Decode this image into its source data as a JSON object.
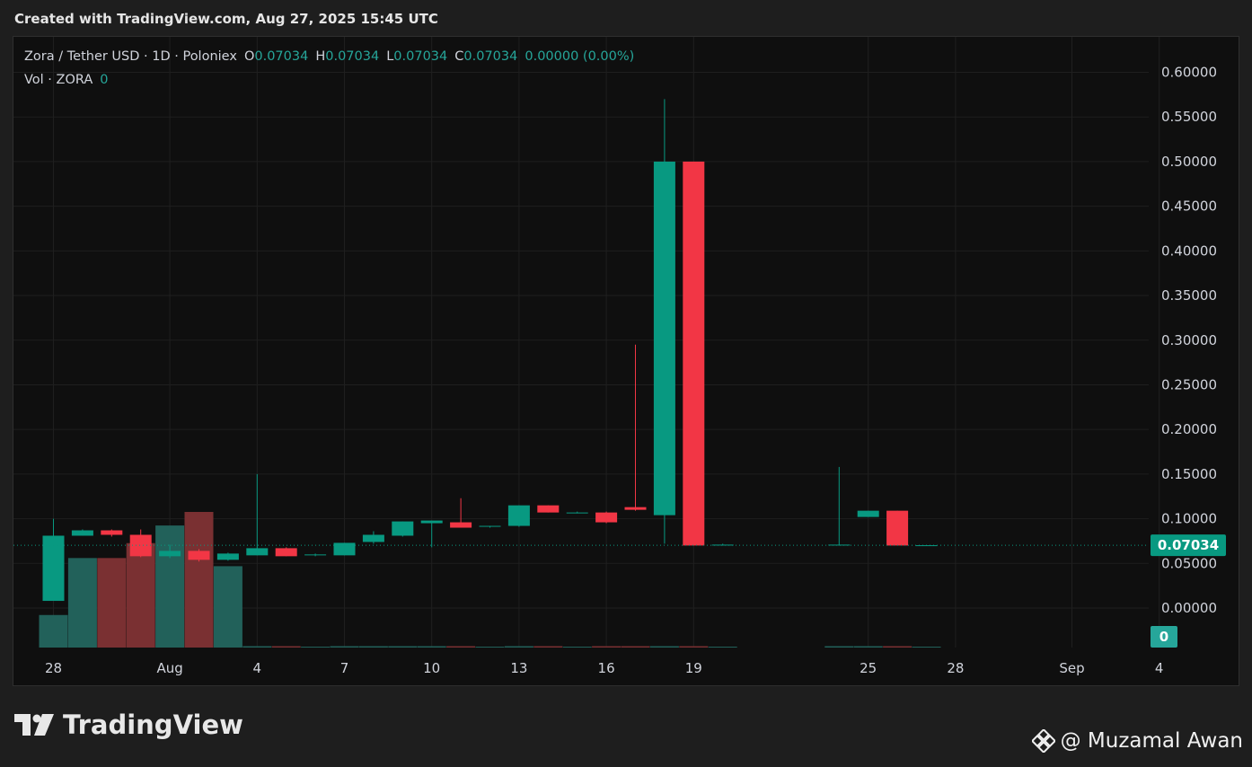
{
  "header": {
    "created_text": "Created with TradingView.com, Aug 27, 2025 15:45 UTC"
  },
  "legend": {
    "symbol": "Zora / Tether USD · 1D · Poloniex",
    "o_label": "O",
    "o_value": "0.07034",
    "h_label": "H",
    "h_value": "0.07034",
    "l_label": "L",
    "l_value": "0.07034",
    "c_label": "C",
    "c_value": "0.07034",
    "change": "0.00000 (0.00%)",
    "vol_label": "Vol · ZORA",
    "vol_value": "0"
  },
  "price_tag": "0.07034",
  "volume_tag": "0",
  "footer": {
    "logo_text": "TradingView",
    "credit_text": "@ Muzamal Awan"
  },
  "colors": {
    "up": "#089981",
    "down": "#f23645",
    "vol_up": "#22615a",
    "vol_down": "#7a3032",
    "grid": "#1f1f1f",
    "text": "#d1d4dc",
    "price_tag": "#089981"
  },
  "chart_data": {
    "type": "candlestick",
    "interval": "1D",
    "x_tick_labels": [
      "28",
      "Aug",
      "4",
      "7",
      "10",
      "13",
      "16",
      "19",
      "25",
      "28",
      "Sep",
      "4"
    ],
    "y_tick_labels": [
      "0.60000",
      "0.55000",
      "0.50000",
      "0.45000",
      "0.40000",
      "0.35000",
      "0.30000",
      "0.25000",
      "0.20000",
      "0.15000",
      "0.10000",
      "0.05000",
      "0.00000"
    ],
    "ylim": [
      0.0,
      0.6
    ],
    "grid": true,
    "last_price": 0.07034,
    "candles": [
      {
        "date": "2025-07-28",
        "open": 0.008,
        "high": 0.1,
        "low": 0.008,
        "close": 0.081
      },
      {
        "date": "2025-07-29",
        "open": 0.081,
        "high": 0.088,
        "low": 0.081,
        "close": 0.087
      },
      {
        "date": "2025-07-30",
        "open": 0.087,
        "high": 0.088,
        "low": 0.08,
        "close": 0.082
      },
      {
        "date": "2025-07-31",
        "open": 0.082,
        "high": 0.088,
        "low": 0.057,
        "close": 0.058
      },
      {
        "date": "2025-08-01",
        "open": 0.058,
        "high": 0.071,
        "low": 0.056,
        "close": 0.064
      },
      {
        "date": "2025-08-02",
        "open": 0.064,
        "high": 0.066,
        "low": 0.052,
        "close": 0.054
      },
      {
        "date": "2025-08-03",
        "open": 0.054,
        "high": 0.062,
        "low": 0.053,
        "close": 0.061
      },
      {
        "date": "2025-08-04",
        "open": 0.059,
        "high": 0.15,
        "low": 0.059,
        "close": 0.067
      },
      {
        "date": "2025-08-05",
        "open": 0.067,
        "high": 0.068,
        "low": 0.058,
        "close": 0.058
      },
      {
        "date": "2025-08-06",
        "open": 0.06,
        "high": 0.061,
        "low": 0.058,
        "close": 0.06
      },
      {
        "date": "2025-08-07",
        "open": 0.059,
        "high": 0.073,
        "low": 0.059,
        "close": 0.073
      },
      {
        "date": "2025-08-08",
        "open": 0.074,
        "high": 0.086,
        "low": 0.072,
        "close": 0.082
      },
      {
        "date": "2025-08-09",
        "open": 0.081,
        "high": 0.097,
        "low": 0.08,
        "close": 0.097
      },
      {
        "date": "2025-08-10",
        "open": 0.095,
        "high": 0.098,
        "low": 0.068,
        "close": 0.098
      },
      {
        "date": "2025-08-11",
        "open": 0.096,
        "high": 0.123,
        "low": 0.09,
        "close": 0.09
      },
      {
        "date": "2025-08-12",
        "open": 0.092,
        "high": 0.092,
        "low": 0.09,
        "close": 0.092
      },
      {
        "date": "2025-08-13",
        "open": 0.092,
        "high": 0.115,
        "low": 0.091,
        "close": 0.115
      },
      {
        "date": "2025-08-14",
        "open": 0.115,
        "high": 0.115,
        "low": 0.107,
        "close": 0.107
      },
      {
        "date": "2025-08-15",
        "open": 0.107,
        "high": 0.108,
        "low": 0.106,
        "close": 0.107
      },
      {
        "date": "2025-08-16",
        "open": 0.107,
        "high": 0.108,
        "low": 0.095,
        "close": 0.096
      },
      {
        "date": "2025-08-17",
        "open": 0.113,
        "high": 0.295,
        "low": 0.109,
        "close": 0.11
      },
      {
        "date": "2025-08-18",
        "open": 0.104,
        "high": 0.57,
        "low": 0.072,
        "close": 0.5
      },
      {
        "date": "2025-08-19",
        "open": 0.5,
        "high": 0.5,
        "low": 0.07,
        "close": 0.07
      },
      {
        "date": "2025-08-20",
        "open": 0.071,
        "high": 0.072,
        "low": 0.07,
        "close": 0.071
      },
      {
        "date": "2025-08-24",
        "open": 0.07,
        "high": 0.158,
        "low": 0.07,
        "close": 0.071
      },
      {
        "date": "2025-08-25",
        "open": 0.102,
        "high": 0.109,
        "low": 0.102,
        "close": 0.109
      },
      {
        "date": "2025-08-26",
        "open": 0.109,
        "high": 0.109,
        "low": 0.07,
        "close": 0.07
      },
      {
        "date": "2025-08-27",
        "open": 0.07034,
        "high": 0.07034,
        "low": 0.07034,
        "close": 0.07034
      }
    ],
    "volume": [
      {
        "date": "2025-07-28",
        "value": 0.24,
        "dir": "up"
      },
      {
        "date": "2025-07-29",
        "value": 0.66,
        "dir": "up"
      },
      {
        "date": "2025-07-30",
        "value": 0.66,
        "dir": "down"
      },
      {
        "date": "2025-07-31",
        "value": 0.77,
        "dir": "down"
      },
      {
        "date": "2025-08-01",
        "value": 0.9,
        "dir": "up"
      },
      {
        "date": "2025-08-02",
        "value": 1.0,
        "dir": "down"
      },
      {
        "date": "2025-08-03",
        "value": 0.6,
        "dir": "up"
      },
      {
        "date": "2025-08-04",
        "value": 0.01,
        "dir": "up"
      },
      {
        "date": "2025-08-05",
        "value": 0.01,
        "dir": "down"
      },
      {
        "date": "2025-08-06",
        "value": 0.005,
        "dir": "up"
      },
      {
        "date": "2025-08-07",
        "value": 0.01,
        "dir": "up"
      },
      {
        "date": "2025-08-08",
        "value": 0.01,
        "dir": "up"
      },
      {
        "date": "2025-08-09",
        "value": 0.01,
        "dir": "up"
      },
      {
        "date": "2025-08-10",
        "value": 0.01,
        "dir": "up"
      },
      {
        "date": "2025-08-11",
        "value": 0.01,
        "dir": "down"
      },
      {
        "date": "2025-08-12",
        "value": 0.005,
        "dir": "up"
      },
      {
        "date": "2025-08-13",
        "value": 0.01,
        "dir": "up"
      },
      {
        "date": "2025-08-14",
        "value": 0.01,
        "dir": "down"
      },
      {
        "date": "2025-08-15",
        "value": 0.005,
        "dir": "up"
      },
      {
        "date": "2025-08-16",
        "value": 0.01,
        "dir": "down"
      },
      {
        "date": "2025-08-17",
        "value": 0.01,
        "dir": "down"
      },
      {
        "date": "2025-08-18",
        "value": 0.01,
        "dir": "up"
      },
      {
        "date": "2025-08-19",
        "value": 0.01,
        "dir": "down"
      },
      {
        "date": "2025-08-20",
        "value": 0.005,
        "dir": "up"
      },
      {
        "date": "2025-08-24",
        "value": 0.01,
        "dir": "up"
      },
      {
        "date": "2025-08-25",
        "value": 0.01,
        "dir": "up"
      },
      {
        "date": "2025-08-26",
        "value": 0.01,
        "dir": "down"
      },
      {
        "date": "2025-08-27",
        "value": 0.005,
        "dir": "up"
      }
    ]
  }
}
